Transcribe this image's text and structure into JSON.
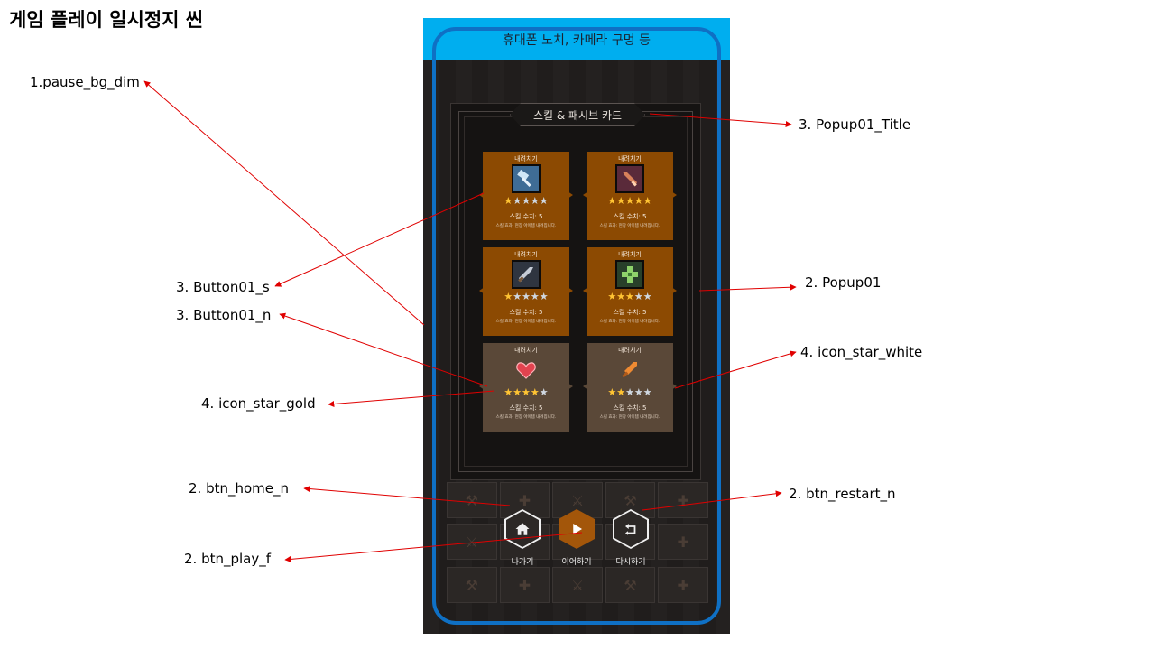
{
  "scene_title": "게임 플레이 일시정지 씬",
  "notch_text": "휴대폰 노치, 카메라 구멍 등",
  "popup_title": "스킬 & 패시브 카드",
  "cards": [
    {
      "head": "내려치기",
      "icon": "hammer-icon",
      "gold_stars": 1,
      "white_stars": 4,
      "stat": "스킬 수치: 5",
      "desc": "스킬 효과: 현장 아이템 내려칩니다.",
      "state": "selected"
    },
    {
      "head": "내려치기",
      "icon": "sword-icon",
      "gold_stars": 5,
      "white_stars": 0,
      "stat": "스킬 수치: 5",
      "desc": "스킬 효과: 현장 아이템 내려칩니다.",
      "state": "selected"
    },
    {
      "head": "내려치기",
      "icon": "sword-icon",
      "gold_stars": 1,
      "white_stars": 4,
      "stat": "스킬 수치: 5",
      "desc": "스킬 효과: 현장 아이템 내려칩니다.",
      "state": "selected"
    },
    {
      "head": "내려치기",
      "icon": "clover-icon",
      "gold_stars": 3,
      "white_stars": 2,
      "stat": "스킬 수치: 5",
      "desc": "스킬 효과: 현장 아이템 내려칩니다.",
      "state": "selected"
    },
    {
      "head": "내려치기",
      "icon": "heart-icon",
      "gold_stars": 4,
      "white_stars": 1,
      "stat": "스킬 수치: 5",
      "desc": "스킬 효과: 현장 아이템 내려칩니다.",
      "state": "normal"
    },
    {
      "head": "내려치기",
      "icon": "sword-icon",
      "gold_stars": 2,
      "white_stars": 3,
      "stat": "스킬 수치: 5",
      "desc": "스킬 효과: 현장 아이템 내려칩니다.",
      "state": "normal"
    }
  ],
  "buttons": {
    "home_label": "나가기",
    "play_label": "이어하기",
    "restart_label": "다시하기"
  },
  "annotations": {
    "pause_bg_dim": "1.pause_bg_dim",
    "popup01_title": "3. Popup01_Title",
    "button01_s": "3. Button01_s",
    "popup01": "2. Popup01",
    "button01_n": "3. Button01_n",
    "icon_star_white": "4. icon_star_white",
    "icon_star_gold": "4. icon_star_gold",
    "btn_home_n": "2. btn_home_n",
    "btn_restart_n": "2. btn_restart_n",
    "btn_play_f": "2. btn_play_f"
  },
  "colors": {
    "notch": "#00aeef",
    "safe_frame": "#0f70c4",
    "card_selected": "#8c4a02",
    "card_normal": "#5a4838",
    "star_gold": "#ffc433",
    "star_white": "#cfd7e0",
    "arrow": "#e00000"
  }
}
